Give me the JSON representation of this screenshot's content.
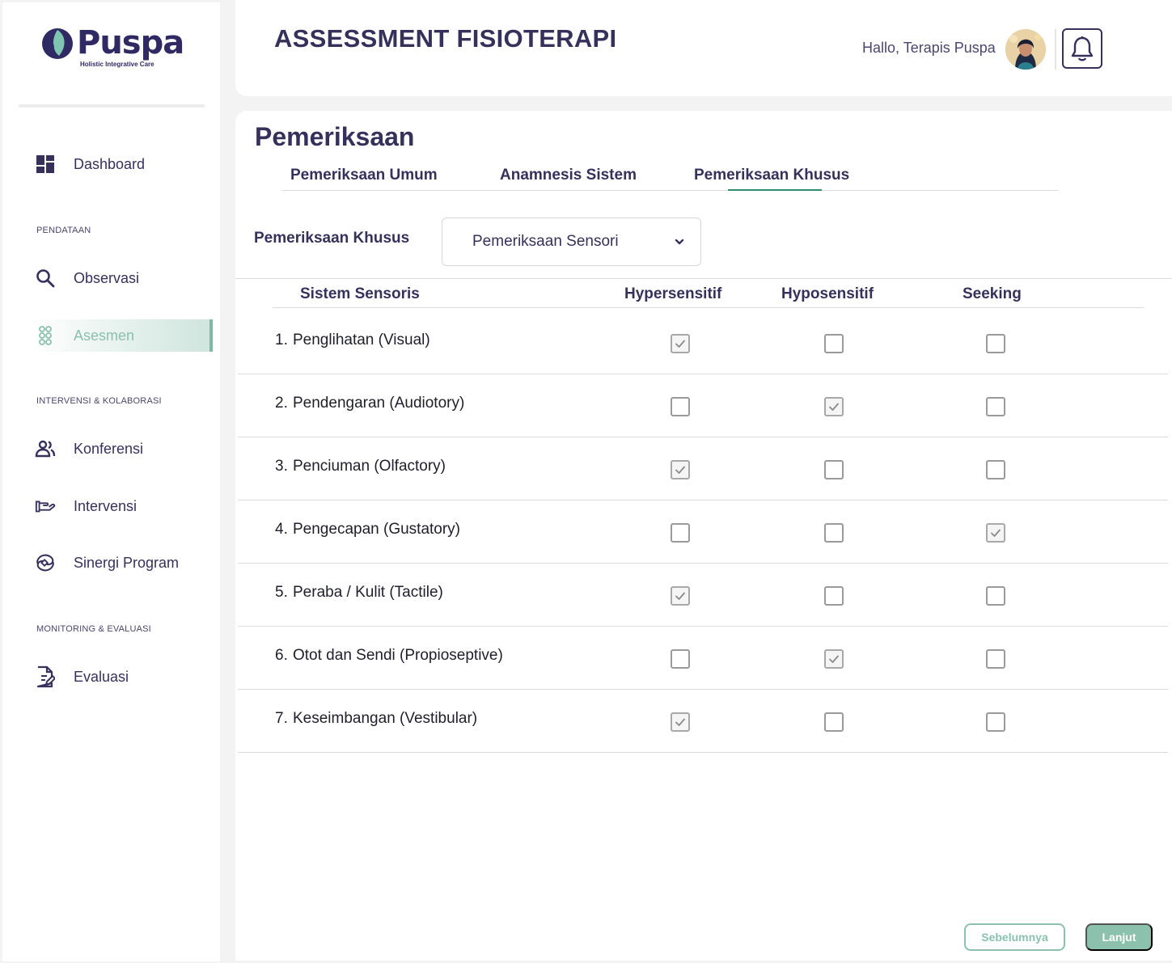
{
  "brand": {
    "name": "Puspa",
    "tagline": "Holistic Integrative Care",
    "accent_color": "#8cc1ae",
    "primary_color": "#36315b"
  },
  "sidebar": {
    "items": [
      {
        "label": "Dashboard",
        "icon": "dashboard-icon"
      },
      {
        "label": "Observasi",
        "icon": "search-icon"
      },
      {
        "label": "Asesmen",
        "icon": "assessment-icon",
        "active": true
      },
      {
        "label": "Konferensi",
        "icon": "people-icon"
      },
      {
        "label": "Intervensi",
        "icon": "hand-icon"
      },
      {
        "label": "Sinergi Program",
        "icon": "synergy-icon"
      },
      {
        "label": "Evaluasi",
        "icon": "document-edit-icon"
      }
    ],
    "sections": [
      "PENDATAAN",
      "INTERVENSI & KOLABORASI",
      "MONITORING & EVALUASI"
    ]
  },
  "header": {
    "title": "ASSESSMENT FISIOTERAPI",
    "greeting": "Hallo, Terapis Puspa"
  },
  "main": {
    "section_title": "Pemeriksaan",
    "tabs": [
      {
        "label": "Pemeriksaan Umum"
      },
      {
        "label": "Anamnesis Sistem"
      },
      {
        "label": "Pemeriksaan Khusus",
        "active": true
      }
    ],
    "field_label": "Pemeriksaan Khusus",
    "select_value": "Pemeriksaan Sensori",
    "table": {
      "headers": [
        "Sistem Sensoris",
        "Hypersensitif",
        "Hyposensitif",
        "Seeking"
      ],
      "rows": [
        {
          "num": "1.",
          "label": "Penglihatan (Visual)",
          "checks": [
            true,
            false,
            false
          ]
        },
        {
          "num": "2.",
          "label": "Pendengaran (Audiotory)",
          "checks": [
            false,
            true,
            false
          ]
        },
        {
          "num": "3.",
          "label": "Penciuman (Olfactory)",
          "checks": [
            true,
            false,
            false
          ]
        },
        {
          "num": "4.",
          "label": "Pengecapan (Gustatory)",
          "checks": [
            false,
            false,
            true
          ]
        },
        {
          "num": "5.",
          "label": "Peraba / Kulit (Tactile)",
          "checks": [
            true,
            false,
            false
          ]
        },
        {
          "num": "6.",
          "label": "Otot dan Sendi (Propioseptive)",
          "checks": [
            false,
            true,
            false
          ]
        },
        {
          "num": "7.",
          "label": "Keseimbangan (Vestibular)",
          "checks": [
            true,
            false,
            false
          ]
        }
      ]
    },
    "buttons": {
      "prev": "Sebelumnya",
      "next": "Lanjut"
    }
  }
}
